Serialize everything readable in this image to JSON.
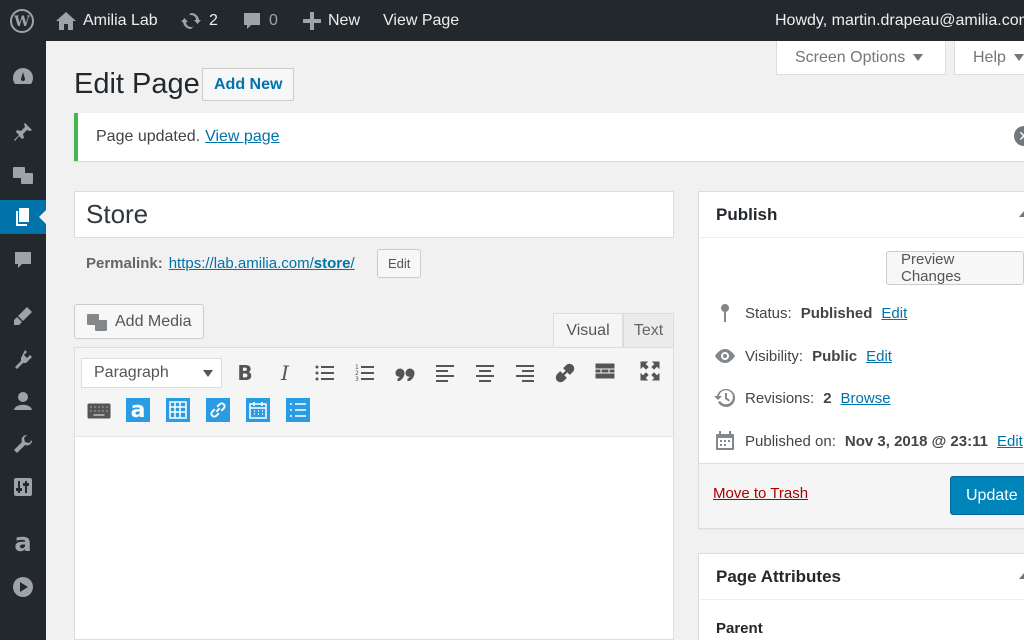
{
  "adminbar": {
    "site_name": "Amilia Lab",
    "updates_count": "2",
    "comments_count": "0",
    "new_label": "New",
    "view_page_label": "View Page",
    "howdy": "Howdy, martin.drapeau@amilia.com"
  },
  "sidemenu": {
    "icons": [
      "dashboard-icon",
      "pin-icon",
      "media-icon",
      "pages-icon",
      "comments-icon",
      "appearance-icon",
      "plugins-icon",
      "users-icon",
      "tools-icon",
      "settings-icon",
      "amilia-icon",
      "play-icon"
    ]
  },
  "screen_tabs": {
    "screen_options": "Screen Options",
    "help": "Help"
  },
  "header": {
    "title": "Edit Page",
    "add_new": "Add New"
  },
  "notice": {
    "text": "Page updated.",
    "link": "View page"
  },
  "post": {
    "title": "Store",
    "permalink_label": "Permalink:",
    "permalink_base": "https://lab.amilia.com/",
    "permalink_slug": "store",
    "permalink_trail": "/",
    "permalink_edit": "Edit"
  },
  "editor": {
    "add_media": "Add Media",
    "tab_visual": "Visual",
    "tab_text": "Text",
    "format": "Paragraph",
    "plugin_a": "a"
  },
  "publish": {
    "title": "Publish",
    "preview": "Preview Changes",
    "status_label": "Status:",
    "status_value": "Published",
    "visibility_label": "Visibility:",
    "visibility_value": "Public",
    "revisions_label": "Revisions:",
    "revisions_value": "2",
    "browse": "Browse",
    "published_label": "Published on:",
    "published_value": "Nov 3, 2018 @ 23:11",
    "edit": "Edit",
    "trash": "Move to Trash",
    "update": "Update"
  },
  "attributes": {
    "title": "Page Attributes",
    "parent": "Parent"
  },
  "colors": {
    "adminbar": "#23282d",
    "accent": "#0073aa",
    "primary_button": "#0085ba",
    "notice_success": "#46b450"
  }
}
